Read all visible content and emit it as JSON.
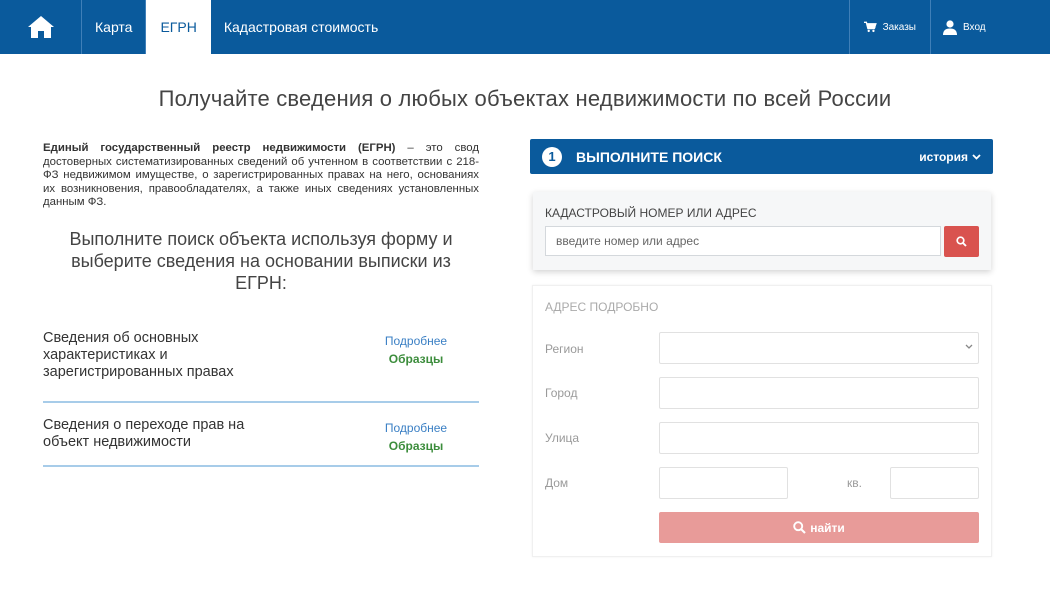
{
  "nav": {
    "items": [
      {
        "label": "Карта"
      },
      {
        "label": "ЕГРН"
      },
      {
        "label": "Кадастровая стоимость"
      }
    ],
    "orders": "Заказы",
    "login": "Вход"
  },
  "title": "Получайте сведения о любых объектах недвижимости по всей России",
  "intro": {
    "bold": "Единый государственный реестр недвижимости (ЕГРН)",
    "text": " – это свод достоверных систематизированных сведений об учтенном в соответствии с 218-ФЗ недвижимом имуществе, о зарегистрированных правах на него, основаниях их возникновения, правообладателях, а также иных сведениях установленных данным ФЗ."
  },
  "subheading": "Выполните поиск объекта используя форму и выберите сведения на основании выписки из ЕГРН:",
  "services": [
    {
      "name": "Сведения об основных характеристиках и зарегистрированных правах",
      "more": "Подробнее",
      "samples": "Образцы"
    },
    {
      "name": "Сведения о переходе прав на объект недвижимости",
      "more": "Подробнее",
      "samples": "Образцы"
    }
  ],
  "step": {
    "number": "1",
    "title": "Выполните поиск",
    "history": "история"
  },
  "search": {
    "label": "Кадастровый номер или адрес",
    "placeholder": "введите номер или адрес",
    "value": ""
  },
  "address": {
    "title": "Адрес подробно",
    "region": "Регион",
    "city": "Город",
    "street": "Улица",
    "house": "Дом",
    "apt": "кв.",
    "find": "найти"
  },
  "colors": {
    "brand": "#0a5a9c",
    "search_button": "#d9534f",
    "find_button": "#e89b99",
    "link": "#3a7fc4",
    "samples": "#3c8d3c",
    "divider": "#a7cce9"
  },
  "icons": {
    "home": "home-icon",
    "cart": "cart-icon",
    "user": "user-icon",
    "chevron": "chevron-down-icon",
    "search": "search-icon"
  }
}
